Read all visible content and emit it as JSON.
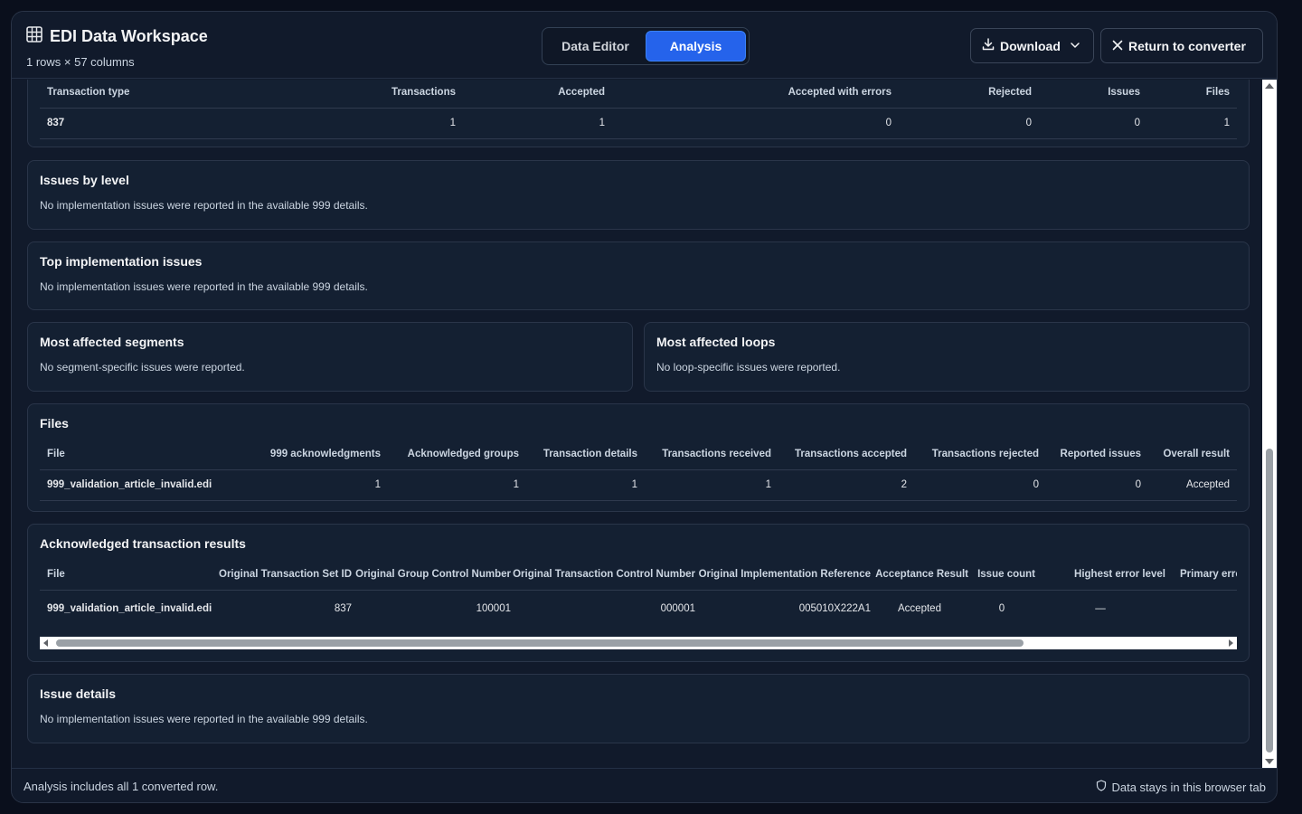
{
  "header": {
    "title": "EDI Data Workspace",
    "subtitle": "1 rows × 57 columns",
    "tabs": [
      {
        "label": "Data Editor",
        "active": false
      },
      {
        "label": "Analysis",
        "active": true
      }
    ],
    "download_label": "Download",
    "return_label": "Return to converter"
  },
  "summary": {
    "headers": [
      "Transaction type",
      "Transactions",
      "Accepted",
      "Accepted with errors",
      "Rejected",
      "Issues",
      "Files"
    ],
    "row": [
      "837",
      "1",
      "1",
      "0",
      "0",
      "0",
      "1"
    ]
  },
  "issues_by_level": {
    "title": "Issues by level",
    "text": "No implementation issues were reported in the available 999 details."
  },
  "top_issues": {
    "title": "Top implementation issues",
    "text": "No implementation issues were reported in the available 999 details."
  },
  "segments": {
    "title": "Most affected segments",
    "text": "No segment-specific issues were reported."
  },
  "loops": {
    "title": "Most affected loops",
    "text": "No loop-specific issues were reported."
  },
  "files": {
    "title": "Files",
    "headers": [
      "File",
      "999 acknowledgments",
      "Acknowledged groups",
      "Transaction details",
      "Transactions received",
      "Transactions accepted",
      "Transactions rejected",
      "Reported issues",
      "Overall result"
    ],
    "row": [
      "999_validation_article_invalid.edi",
      "1",
      "1",
      "1",
      "1",
      "2",
      "0",
      "0",
      "Accepted"
    ]
  },
  "ack_results": {
    "title": "Acknowledged transaction results",
    "headers": [
      "File",
      "Original Transaction Set ID",
      "Original Group Control Number",
      "Original Transaction Control Number",
      "Original Implementation Reference",
      "Acceptance Result",
      "Issue count",
      "Highest error level",
      "Primary error summa"
    ],
    "row": [
      "999_validation_article_invalid.edi",
      "837",
      "100001",
      "000001",
      "005010X222A1",
      "Accepted",
      "0",
      "—",
      ""
    ]
  },
  "issue_details": {
    "title": "Issue details",
    "text": "No implementation issues were reported in the available 999 details."
  },
  "footer": {
    "left": "Analysis includes all 1 converted row.",
    "right": "Data stays in this browser tab"
  },
  "colors": {
    "background": "#111a2b",
    "accent": "#2563eb",
    "card": "#142032"
  },
  "icons": [
    "table-grid-icon",
    "download-icon",
    "chevron-down-icon",
    "close-icon",
    "shield-icon"
  ]
}
